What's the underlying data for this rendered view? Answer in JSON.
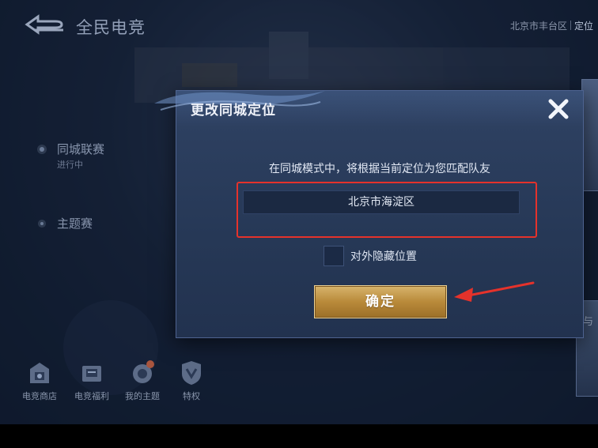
{
  "header": {
    "app_title": "全民电竞",
    "current_location": "北京市丰台区",
    "locate_button": "定位"
  },
  "side_menu": {
    "items": [
      {
        "label": "同城联赛",
        "sub": "进行中"
      },
      {
        "label": "主题赛",
        "sub": ""
      }
    ]
  },
  "bottom_bar": {
    "items": [
      {
        "label": "电竞商店",
        "icon": "shop-icon"
      },
      {
        "label": "电竞福利",
        "icon": "gift-icon"
      },
      {
        "label": "我的主题",
        "icon": "theme-icon"
      },
      {
        "label": "特权",
        "icon": "privilege-icon"
      }
    ]
  },
  "right_panel": {
    "partial_text": "与"
  },
  "dialog": {
    "title": "更改同城定位",
    "message": "在同城模式中，将根据当前定位为您匹配队友",
    "location_value": "北京市海淀区",
    "hide_location_label": "对外隐藏位置",
    "hide_location_checked": false,
    "confirm_label": "确定",
    "highlight_color": "#e5322b",
    "confirm_color": "#c79a4a"
  }
}
